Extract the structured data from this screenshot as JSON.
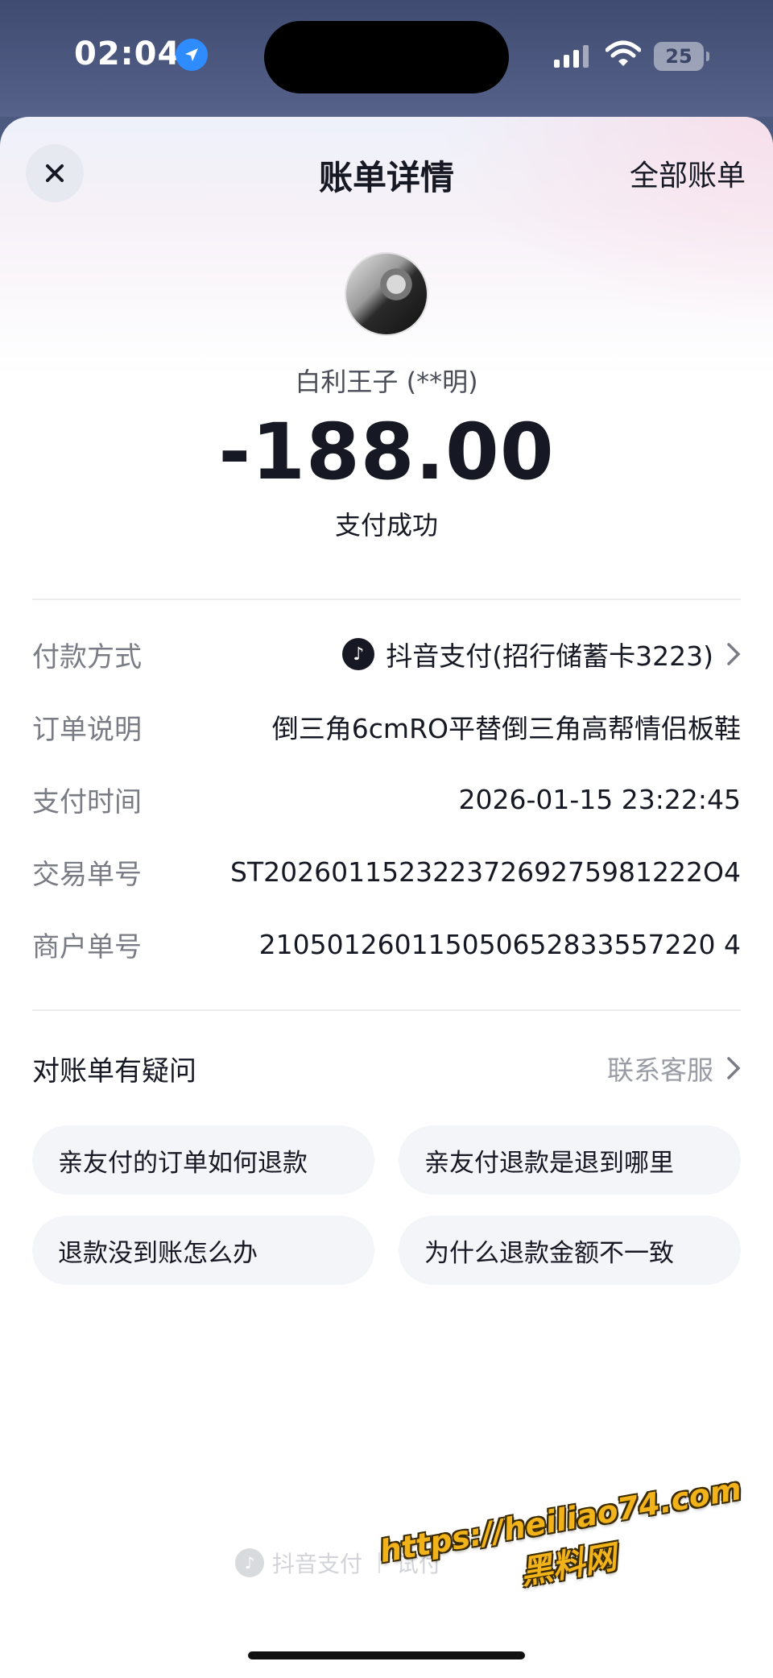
{
  "status_bar": {
    "time": "02:04",
    "battery": "25",
    "icons": [
      "location-arrow-icon",
      "signal-icon",
      "wifi-icon",
      "battery-icon"
    ]
  },
  "header": {
    "title": "账单详情",
    "all_bills": "全部账单",
    "close_icon": "close-icon"
  },
  "summary": {
    "payee": "白利王子 (**明)",
    "amount": "-188.00",
    "status": "支付成功"
  },
  "details": [
    {
      "label": "付款方式",
      "value": "抖音支付(招行储蓄卡3223)"
    },
    {
      "label": "订单说明",
      "value": "倒三角6cmRO平替倒三角高帮情侣板鞋"
    },
    {
      "label": "支付时间",
      "value": "2026-01-15 23:22:45"
    },
    {
      "label": "交易单号",
      "value": "ST20260115232237269275981222O4"
    },
    {
      "label": "商户单号",
      "value": "210501260115050652833557220 4"
    }
  ],
  "help": {
    "title": "对账单有疑问",
    "contact": "联系客服",
    "faqs": [
      "亲友付的订单如何退款",
      "亲友付退款是退到哪里",
      "退款没到账怎么办",
      "为什么退款金额不一致"
    ]
  },
  "footer": {
    "brand": "抖音支付",
    "tail": "试付"
  },
  "watermark": {
    "url": "https://heiliao74.com",
    "name": "黑料网"
  },
  "colors": {
    "text_primary": "#161823",
    "text_secondary": "#7a7c85",
    "watermark": "#f2b21a"
  }
}
